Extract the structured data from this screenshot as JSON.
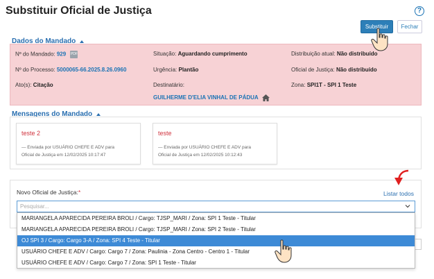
{
  "page": {
    "title": "Substituir Oficial de Justiça"
  },
  "header": {
    "help_icon": "?",
    "substituir_label": "Substituir",
    "fechar_label": "Fechar"
  },
  "dados": {
    "section_label": "Dados do Mandado",
    "mandado_label": "Nº do Mandado:",
    "mandado_value": "929",
    "pdf_icon": "PDF",
    "situacao_label": "Situação:",
    "situacao_value": "Aguardando cumprimento",
    "distribuicao_label": "Distribuição atual:",
    "distribuicao_value": "Não distribuído",
    "processo_label": "Nº do Processo:",
    "processo_value": "5000065-66.2025.8.26.0960",
    "urgencia_label": "Urgência:",
    "urgencia_value": "Plantão",
    "oficial_label": "Oficial de Justiça:",
    "oficial_value": "Não distribuído",
    "atos_label": "Ato(s):",
    "atos_value": "Citação",
    "destinatario_label": "Destinatário:",
    "destinatario_value": "GUILHERME D'ELIA VINHAL DE PÁDUA",
    "zona_label": "Zona:",
    "zona_value": "SPI1T - SPI 1 Teste"
  },
  "mensagens": {
    "section_label": "Mensagens do Mandado",
    "items": [
      {
        "title": "teste 2",
        "line1": "— Enviada por USUÁRIO CHEFE E ADV para",
        "line2": "Oficial de Justiça em 12/02/2025 10:17:47"
      },
      {
        "title": "teste",
        "line1": "— Enviada por USUÁRIO CHEFE E ADV para",
        "line2": "Oficial de Justiça em 12/02/2025 10:12:43"
      }
    ]
  },
  "form": {
    "novo_label": "Novo Oficial de Justiça:",
    "required_mark": "*",
    "listar_label": "Listar todos",
    "search_placeholder": "Pesquisar...",
    "options": [
      "MARIANGELA APARECIDA PEREIRA BROLI / Cargo: TJSP_MARI / Zona: SPI 1 Teste - Titular",
      "MARIANGELA APARECIDA PEREIRA BROLI / Cargo: TJSP_MARI / Zona: SPI 2 Teste - Titular",
      "OJ SPI 3 / Cargo: Cargo 3-A / Zona: SPI 4 Teste - Titular",
      "USUÁRIO CHEFE E ADV / Cargo: Cargo 7 / Zona: Paulinia - Zona Centro - Centro 1 - Titular",
      "USUÁRIO CHEFE E ADV / Cargo: Cargo 7 / Zona: SPI 1 Teste - Titular"
    ],
    "selected_index": 2
  },
  "colors": {
    "accent": "#2d7fb8",
    "alert_bg": "#f7d2d5",
    "selected": "#3d8ad6",
    "message_title": "#d0343f"
  }
}
